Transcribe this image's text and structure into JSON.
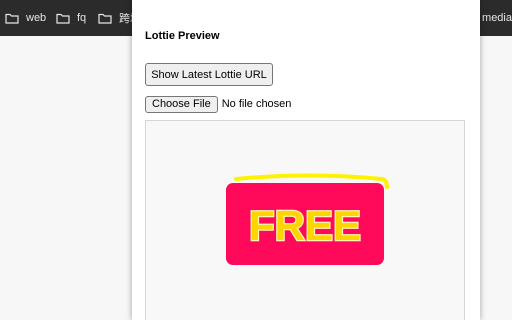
{
  "bookmarks": [
    {
      "label": "web",
      "icon": "folder-icon"
    },
    {
      "label": "fq",
      "icon": "folder-icon"
    },
    {
      "label": "跨境",
      "icon": "folder-icon"
    },
    {
      "label": "media",
      "icon": ""
    }
  ],
  "popup": {
    "title": "Lottie Preview",
    "show_latest_label": "Show Latest Lottie URL",
    "choose_file_label": "Choose File",
    "file_status": "No file chosen",
    "animation": {
      "text": "FREE",
      "badge_color": "#ff0a5a",
      "text_color": "#ffd500",
      "accent_color": "#fff200"
    }
  }
}
